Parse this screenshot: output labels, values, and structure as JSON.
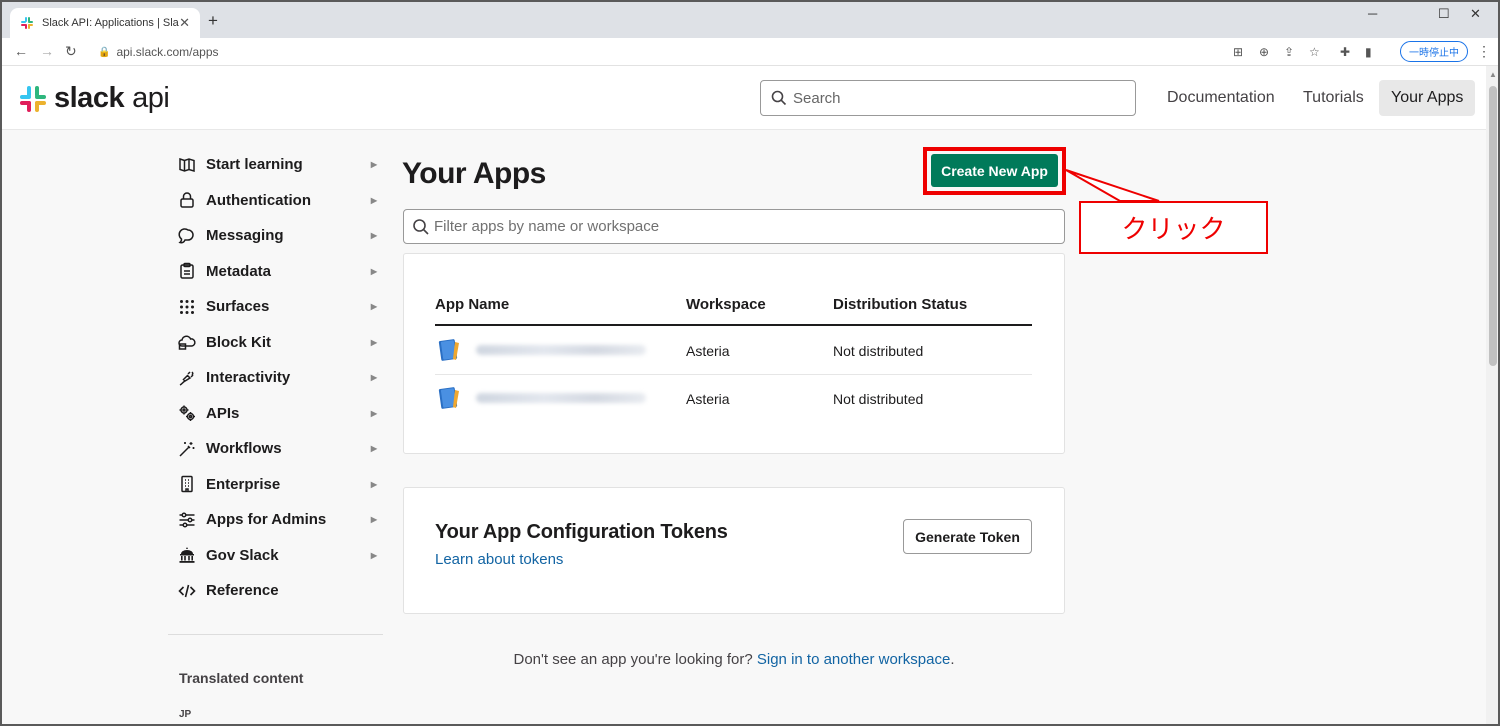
{
  "browser": {
    "tab_title": "Slack API: Applications | Slack",
    "tab_close": "✕",
    "new_tab": "+",
    "url": "api.slack.com/apps",
    "paused_label": "一時停止中",
    "win_min": "─",
    "win_max": "☐",
    "win_close": "✕"
  },
  "header": {
    "logo_text": "slack",
    "logo_suffix": "api",
    "search_placeholder": "Search",
    "nav": [
      {
        "label": "Documentation"
      },
      {
        "label": "Tutorials"
      },
      {
        "label": "Your Apps"
      }
    ]
  },
  "sidebar": {
    "items": [
      {
        "label": "Start learning",
        "icon": "map-icon"
      },
      {
        "label": "Authentication",
        "icon": "lock-icon"
      },
      {
        "label": "Messaging",
        "icon": "chat-icon"
      },
      {
        "label": "Metadata",
        "icon": "clipboard-icon"
      },
      {
        "label": "Surfaces",
        "icon": "grid-icon"
      },
      {
        "label": "Block Kit",
        "icon": "cloud-blocks-icon"
      },
      {
        "label": "Interactivity",
        "icon": "plug-icon"
      },
      {
        "label": "APIs",
        "icon": "gears-icon"
      },
      {
        "label": "Workflows",
        "icon": "wand-icon"
      },
      {
        "label": "Enterprise",
        "icon": "building-icon"
      },
      {
        "label": "Apps for Admins",
        "icon": "sliders-icon"
      },
      {
        "label": "Gov Slack",
        "icon": "government-icon"
      },
      {
        "label": "Reference",
        "icon": "code-icon"
      }
    ],
    "caret": "▶",
    "translated_heading": "Translated content",
    "language": "JP"
  },
  "main": {
    "title": "Your Apps",
    "create_button": "Create New App",
    "filter_placeholder": "Filter apps by name or workspace",
    "table": {
      "headers": [
        "App Name",
        "Workspace",
        "Distribution Status"
      ],
      "rows": [
        {
          "workspace": "Asteria",
          "status": "Not distributed"
        },
        {
          "workspace": "Asteria",
          "status": "Not distributed"
        }
      ]
    },
    "tokens": {
      "title": "Your App Configuration Tokens",
      "link": "Learn about tokens",
      "button": "Generate Token"
    },
    "footer": {
      "text": "Don't see an app you're looking for?",
      "link": "Sign in to another workspace",
      "end": "."
    }
  },
  "annotation": {
    "label": "クリック",
    "color": "#ee0000"
  },
  "colors": {
    "brand_green": "#007a5a",
    "link_blue": "#1264a3"
  }
}
